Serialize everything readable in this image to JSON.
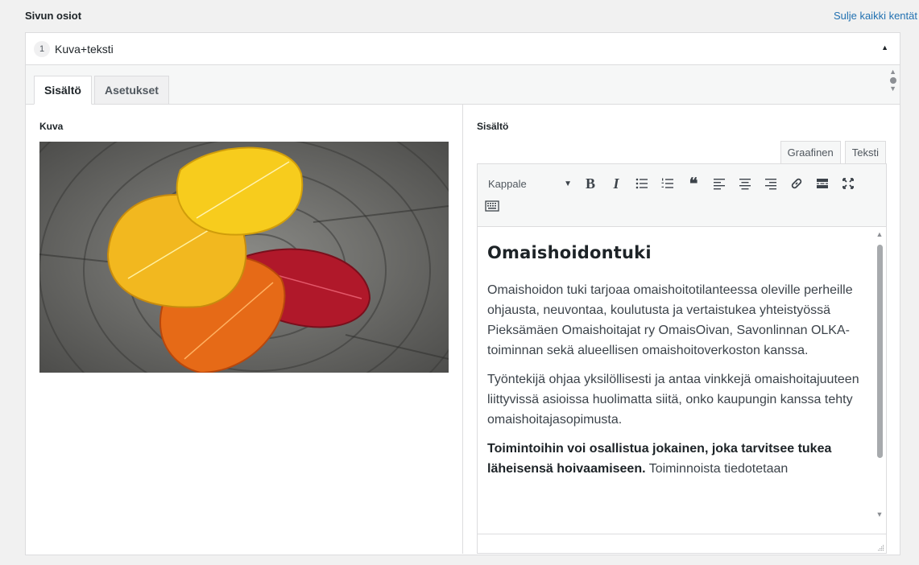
{
  "header": {
    "section_title": "Sivun osiot",
    "collapse_all": "Sulje kaikki kentät"
  },
  "layout": {
    "number": "1",
    "name": "Kuva+teksti",
    "tabs": [
      {
        "label": "Sisältö",
        "active": true
      },
      {
        "label": "Asetukset",
        "active": false
      }
    ]
  },
  "left": {
    "field_label": "Kuva",
    "image_description": "autumn aspen leaves on wood"
  },
  "right": {
    "field_label": "Sisältö",
    "editor_tabs": [
      {
        "label": "Graafinen",
        "active": true
      },
      {
        "label": "Teksti",
        "active": false
      }
    ],
    "format_select": "Kappale",
    "toolbar_icons": [
      "bold-icon",
      "italic-icon",
      "bullet-list-icon",
      "numbered-list-icon",
      "blockquote-icon",
      "align-left-icon",
      "align-center-icon",
      "align-right-icon",
      "link-icon",
      "read-more-icon",
      "fullscreen-icon",
      "toolbar-toggle-icon"
    ]
  },
  "content": {
    "heading": "Omaishoidontuki",
    "paragraph1": "Omaishoidon tuki tarjoaa omaishoitotilanteessa oleville perheille ohjausta, neuvontaa, koulutusta ja vertaistukea yhteistyössä Pieksämäen Omaishoitajat ry OmaisOivan, Savonlinnan OLKA-toiminnan sekä alueellisen omaishoitoverkoston kanssa.",
    "paragraph2": "Työntekijä ohjaa yksilöllisesti ja antaa vinkkejä omaishoitajuuteen liittyvissä asioissa huolimatta siitä, onko kaupungin kanssa tehty omaishoitajasopimusta.",
    "paragraph3_bold": "Toimintoihin voi osallistua jokainen, joka tarvitsee tukea läheisensä hoivaamiseen.",
    "paragraph3_rest": " Toiminnoista tiedotetaan"
  }
}
